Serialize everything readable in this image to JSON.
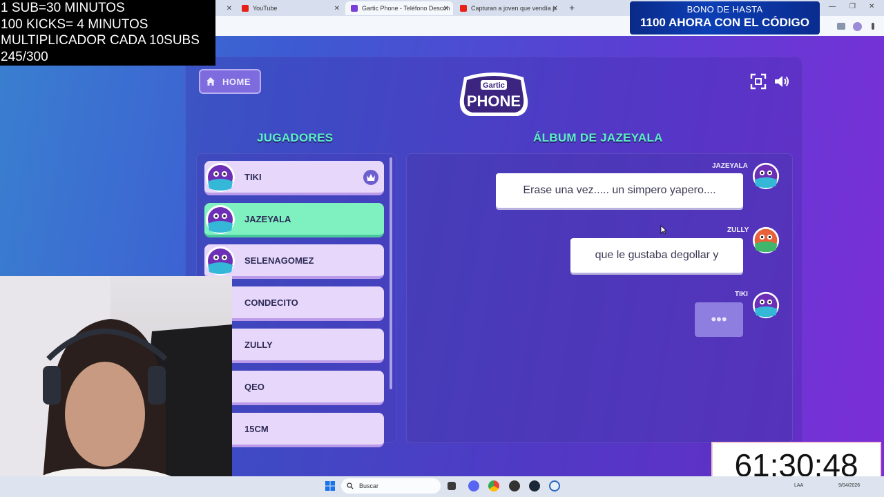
{
  "browser": {
    "tabs": [
      {
        "label": "YouTube",
        "color": "#e62117"
      },
      {
        "label": "Gartic Phone - Teléfono Descon",
        "color": "#7a3fd8"
      },
      {
        "label": "Capturan a joven que vendía p",
        "color": "#e62117"
      }
    ]
  },
  "stream_info": {
    "lines": [
      "1 SUB=30 MINUTOS",
      "100 KICKS= 4 MINUTOS",
      "MULTIPLICADOR CADA 10SUBS",
      "245/300"
    ]
  },
  "promo": {
    "line1": "BONO DE HASTA",
    "line2": "1100 AHORA CON EL CÓDIGO"
  },
  "game": {
    "home_label": "HOME",
    "logo_top": "Gartic",
    "logo_bottom": "PHONE",
    "players_title": "JUGADORES",
    "album_title": "ÁLBUM DE JAZEYALA",
    "players": [
      {
        "name": "TIKI",
        "host": true,
        "active": false
      },
      {
        "name": "JAZEYALA",
        "host": false,
        "active": true
      },
      {
        "name": "SELENAGOMEZ",
        "host": false,
        "active": false
      },
      {
        "name": "CONDECITO",
        "host": false,
        "active": false
      },
      {
        "name": "ZULLY",
        "host": false,
        "active": false
      },
      {
        "name": "QEO",
        "host": false,
        "active": false
      },
      {
        "name": "15CM",
        "host": false,
        "active": false
      }
    ],
    "messages": [
      {
        "author": "JAZEYALA",
        "text": "Erase una vez..... un simpero yapero...."
      },
      {
        "author": "ZULLY",
        "text": "que le gustaba degollar y"
      },
      {
        "author": "TIKI",
        "text": "•••"
      }
    ]
  },
  "timer": "61:30:48",
  "taskbar": {
    "search_placeholder": "Buscar",
    "lang": "LAA",
    "date": "9/04/2026"
  }
}
